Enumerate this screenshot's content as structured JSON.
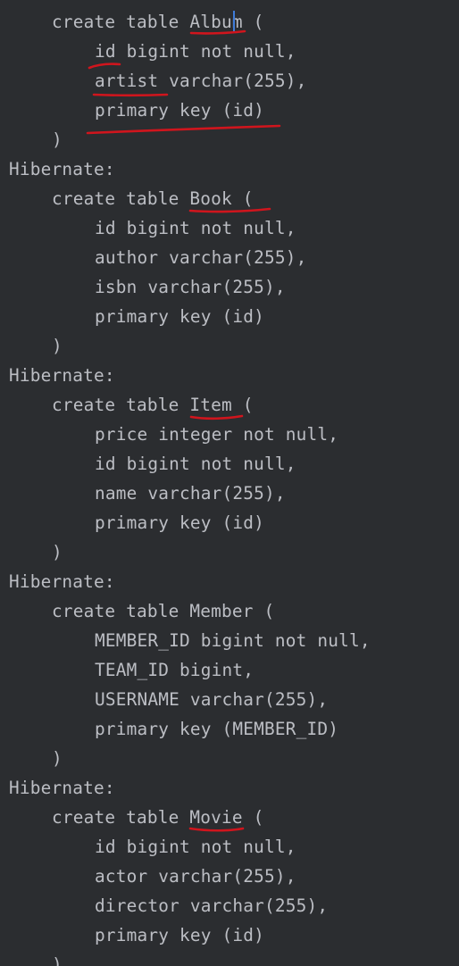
{
  "console": {
    "lines": [
      "create table Album (",
      "id bigint not null,",
      "artist varchar(255),",
      "primary key (id)",
      ")",
      "Hibernate:",
      "create table Book (",
      "id bigint not null,",
      "author varchar(255),",
      "isbn varchar(255),",
      "primary key (id)",
      ")",
      "Hibernate:",
      "create table Item (",
      "price integer not null,",
      "id bigint not null,",
      "name varchar(255),",
      "primary key (id)",
      ")",
      "Hibernate:",
      "create table Member (",
      "MEMBER_ID bigint not null,",
      "TEAM_ID bigint,",
      "USERNAME varchar(255),",
      "primary key (MEMBER_ID)",
      ")",
      "Hibernate:",
      "create table Movie (",
      "id bigint not null,",
      "actor varchar(255),",
      "director varchar(255),",
      "primary key (id)",
      ")"
    ]
  },
  "colors": {
    "background": "#2b2d30",
    "text": "#bcbec4",
    "annotation": "#d0151d",
    "caret": "#3f7cd8"
  }
}
